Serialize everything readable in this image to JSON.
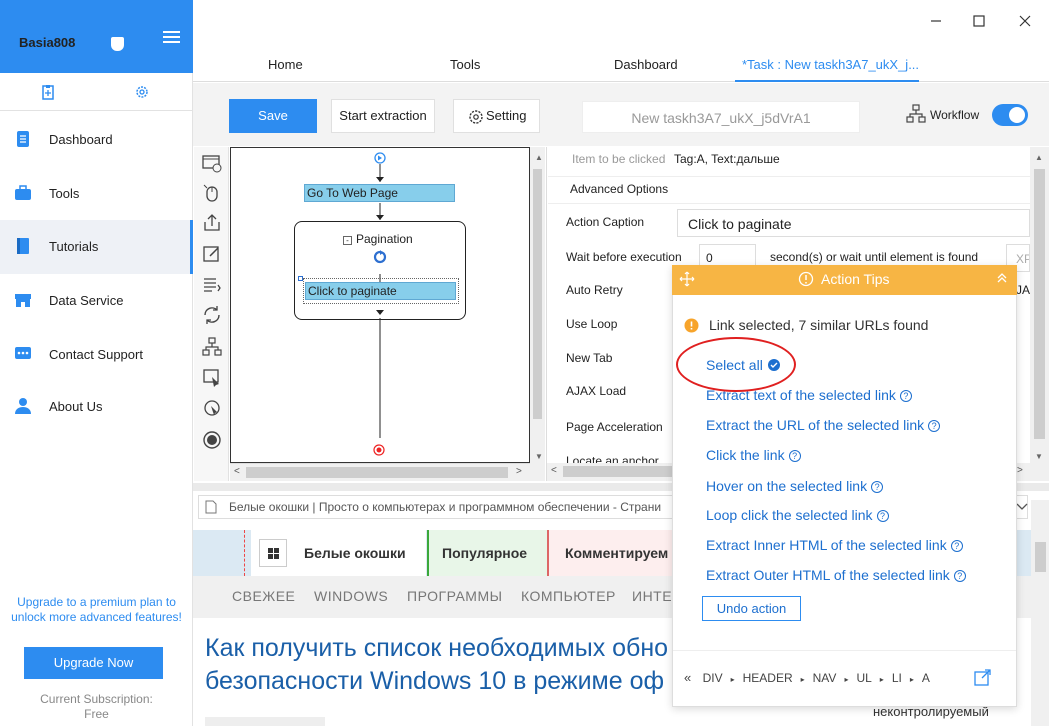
{
  "sidebar": {
    "username": "Basia808",
    "items": [
      {
        "label": "Dashboard"
      },
      {
        "label": "Tools"
      },
      {
        "label": "Tutorials"
      },
      {
        "label": "Data Service"
      },
      {
        "label": "Contact Support"
      },
      {
        "label": "About Us"
      }
    ],
    "active": "Tutorials",
    "upgrade_text_1": "Upgrade to a premium plan to",
    "upgrade_text_2": "unlock more advanced features!",
    "upgrade_button": "Upgrade Now",
    "subscription_label": "Current Subscription:",
    "subscription_value": "Free",
    "accent": "#2d8cf0"
  },
  "tabs": [
    {
      "label": "Home"
    },
    {
      "label": "Tools"
    },
    {
      "label": "Dashboard"
    },
    {
      "label": "*Task : New taskh3A7_ukX_j..."
    }
  ],
  "toolbar": {
    "save": "Save",
    "start": "Start extraction",
    "setting": "Setting",
    "task_name": "New taskh3A7_ukX_j5dVrA1",
    "workflow": "Workflow",
    "workflow_on": true
  },
  "workflow": {
    "nodes": {
      "goto": "Go To Web Page",
      "pagination": "Pagination",
      "click": "Click to paginate"
    }
  },
  "props": {
    "item_label": "Item to be clicked",
    "item_value": "Tag:A, Text:дальше",
    "advanced": "Advanced Options",
    "caption_label": "Action Caption",
    "caption_value": "Click to paginate",
    "wait_label": "Wait before execution",
    "wait_value": "0",
    "wait_suffix": "second(s)  or wait until element is found",
    "wait_input_placeholder": "XP",
    "retry_label": "Auto Retry",
    "retry_suffix": "JA",
    "loop_label": "Use Loop",
    "newtab_label": "New Tab",
    "ajax_label": "AJAX Load",
    "accel_label": "Page Acceleration",
    "anchor_label": "Locate an anchor"
  },
  "browser": {
    "tab_title": "Белые окошки | Просто о компьютерах и программном обеспечении - Страни",
    "site_logo": "Белые окошки",
    "nav_popular": "Популярное",
    "nav_comments": "Комментируем",
    "menu": [
      "СВЕЖЕЕ",
      "WINDOWS",
      "ПРОГРАММЫ",
      "КОМПЬЮТЕР",
      "ИНТЕ"
    ],
    "headline_1": "Как получить список необходимых обно",
    "headline_2": "безопасности Windows 10 в режиме оф",
    "footer_fragment": "неконтролируемый"
  },
  "tips": {
    "title": "Action Tips",
    "status": "Link selected, 7 similar URLs found",
    "select_all": "Select all",
    "links": [
      "Extract text of the selected link",
      "Extract the URL of the selected link",
      "Click the link",
      "Hover on the selected link",
      "Loop click the selected link",
      "Extract Inner HTML of the selected link",
      "Extract Outer HTML of the selected link"
    ],
    "undo": "Undo action",
    "crumbs": [
      "DIV",
      "HEADER",
      "NAV",
      "UL",
      "LI",
      "A"
    ],
    "header_color": "#f7b544"
  }
}
